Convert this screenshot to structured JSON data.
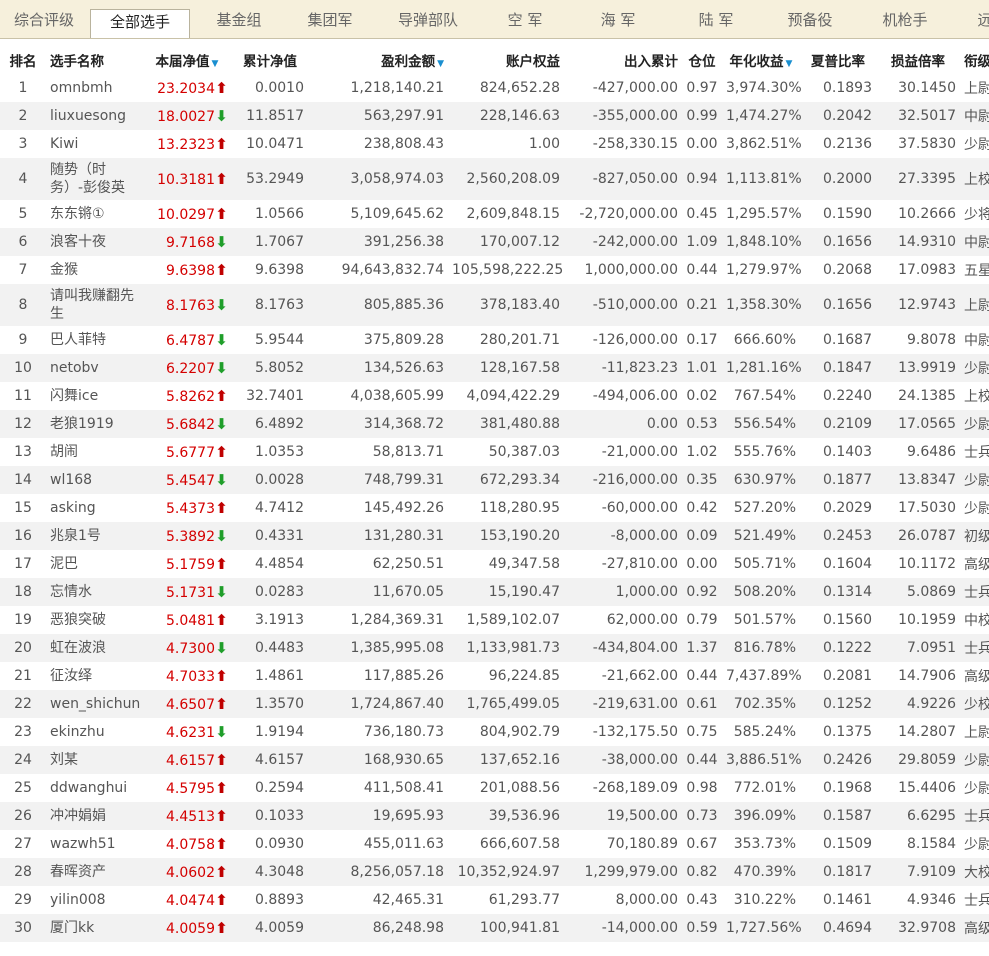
{
  "tabs": [
    {
      "label": "综合评级",
      "active": false
    },
    {
      "label": "全部选手",
      "active": true
    },
    {
      "label": "基金组",
      "active": false
    },
    {
      "label": "集团军",
      "active": false
    },
    {
      "label": "导弹部队",
      "active": false
    },
    {
      "label": "空  军",
      "active": false
    },
    {
      "label": "海  军",
      "active": false
    },
    {
      "label": "陆  军",
      "active": false
    },
    {
      "label": "预备役",
      "active": false
    },
    {
      "label": "机枪手",
      "active": false
    },
    {
      "label": "远",
      "active": false
    }
  ],
  "table": {
    "headers": [
      {
        "label": "排名",
        "sort": false
      },
      {
        "label": "选手名称",
        "sort": false
      },
      {
        "label": "本届净值",
        "sort": true
      },
      {
        "label": "累计净值",
        "sort": false
      },
      {
        "label": "盈利金额",
        "sort": true
      },
      {
        "label": "账户权益",
        "sort": false
      },
      {
        "label": "出入累计",
        "sort": false
      },
      {
        "label": "仓位",
        "sort": false
      },
      {
        "label": "年化收益",
        "sort": true
      },
      {
        "label": "夏普比率",
        "sort": false
      },
      {
        "label": "损益倍率",
        "sort": false
      },
      {
        "label": "衔级",
        "sort": false
      }
    ],
    "sort_arrow": "▼",
    "up_arrow": "⬆",
    "down_arrow": "⬇",
    "rows": [
      {
        "rank": "1",
        "name": "omnbmh",
        "nav": "23.2034",
        "trend": "up",
        "cum": "0.0010",
        "profit": "1,218,140.21",
        "equity": "824,652.28",
        "flow": "-427,000.00",
        "pos": "0.97",
        "annual": "3,974.30%",
        "sharpe": "0.1893",
        "ratio": "30.1450",
        "rank_title": "上尉"
      },
      {
        "rank": "2",
        "name": "liuxuesong",
        "nav": "18.0027",
        "trend": "down",
        "cum": "11.8517",
        "profit": "563,297.91",
        "equity": "228,146.63",
        "flow": "-355,000.00",
        "pos": "0.99",
        "annual": "1,474.27%",
        "sharpe": "0.2042",
        "ratio": "32.5017",
        "rank_title": "中尉"
      },
      {
        "rank": "3",
        "name": "Kiwi",
        "nav": "13.2323",
        "trend": "up",
        "cum": "10.0471",
        "profit": "238,808.43",
        "equity": "1.00",
        "flow": "-258,330.15",
        "pos": "0.00",
        "annual": "3,862.51%",
        "sharpe": "0.2136",
        "ratio": "37.5830",
        "rank_title": "少尉"
      },
      {
        "rank": "4",
        "name": "随势（时务）-彭俊英",
        "nav": "10.3181",
        "trend": "up",
        "cum": "53.2949",
        "profit": "3,058,974.03",
        "equity": "2,560,208.09",
        "flow": "-827,050.00",
        "pos": "0.94",
        "annual": "1,113.81%",
        "sharpe": "0.2000",
        "ratio": "27.3395",
        "rank_title": "上校",
        "tall": true
      },
      {
        "rank": "5",
        "name": "东东锵①",
        "nav": "10.0297",
        "trend": "up",
        "cum": "1.0566",
        "profit": "5,109,645.62",
        "equity": "2,609,848.15",
        "flow": "-2,720,000.00",
        "pos": "0.45",
        "annual": "1,295.57%",
        "sharpe": "0.1590",
        "ratio": "10.2666",
        "rank_title": "少将"
      },
      {
        "rank": "6",
        "name": "浪客十夜",
        "nav": "9.7168",
        "trend": "down",
        "cum": "1.7067",
        "profit": "391,256.38",
        "equity": "170,007.12",
        "flow": "-242,000.00",
        "pos": "1.09",
        "annual": "1,848.10%",
        "sharpe": "0.1656",
        "ratio": "14.9310",
        "rank_title": "中尉"
      },
      {
        "rank": "7",
        "name": "金猴",
        "nav": "9.6398",
        "trend": "up",
        "cum": "9.6398",
        "profit": "94,643,832.74",
        "equity": "105,598,222.25",
        "flow": "1,000,000.00",
        "pos": "0.44",
        "annual": "1,279.97%",
        "sharpe": "0.2068",
        "ratio": "17.0983",
        "rank_title": "五星上将"
      },
      {
        "rank": "8",
        "name": "请叫我赚翻先生",
        "nav": "8.1763",
        "trend": "down",
        "cum": "8.1763",
        "profit": "805,885.36",
        "equity": "378,183.40",
        "flow": "-510,000.00",
        "pos": "0.21",
        "annual": "1,358.30%",
        "sharpe": "0.1656",
        "ratio": "12.9743",
        "rank_title": "上尉",
        "tall": true
      },
      {
        "rank": "9",
        "name": "巴人菲特",
        "nav": "6.4787",
        "trend": "down",
        "cum": "5.9544",
        "profit": "375,809.28",
        "equity": "280,201.71",
        "flow": "-126,000.00",
        "pos": "0.17",
        "annual": "666.60%",
        "sharpe": "0.1687",
        "ratio": "9.8078",
        "rank_title": "中尉"
      },
      {
        "rank": "10",
        "name": "netobv",
        "nav": "6.2207",
        "trend": "down",
        "cum": "5.8052",
        "profit": "134,526.63",
        "equity": "128,167.58",
        "flow": "-11,823.23",
        "pos": "1.01",
        "annual": "1,281.16%",
        "sharpe": "0.1847",
        "ratio": "13.9919",
        "rank_title": "少尉"
      },
      {
        "rank": "11",
        "name": "闪舞ice",
        "nav": "5.8262",
        "trend": "up",
        "cum": "32.7401",
        "profit": "4,038,605.99",
        "equity": "4,094,422.29",
        "flow": "-494,006.00",
        "pos": "0.02",
        "annual": "767.54%",
        "sharpe": "0.2240",
        "ratio": "24.1385",
        "rank_title": "上校"
      },
      {
        "rank": "12",
        "name": "老狼1919",
        "nav": "5.6842",
        "trend": "down",
        "cum": "6.4892",
        "profit": "314,368.72",
        "equity": "381,480.88",
        "flow": "0.00",
        "pos": "0.53",
        "annual": "556.54%",
        "sharpe": "0.2109",
        "ratio": "17.0565",
        "rank_title": "少尉"
      },
      {
        "rank": "13",
        "name": "胡闹",
        "nav": "5.6777",
        "trend": "up",
        "cum": "1.0353",
        "profit": "58,813.71",
        "equity": "50,387.03",
        "flow": "-21,000.00",
        "pos": "1.02",
        "annual": "555.76%",
        "sharpe": "0.1403",
        "ratio": "9.6486",
        "rank_title": "士兵"
      },
      {
        "rank": "14",
        "name": "wl168",
        "nav": "5.4547",
        "trend": "down",
        "cum": "0.0028",
        "profit": "748,799.31",
        "equity": "672,293.34",
        "flow": "-216,000.00",
        "pos": "0.35",
        "annual": "630.97%",
        "sharpe": "0.1877",
        "ratio": "13.8347",
        "rank_title": "少尉"
      },
      {
        "rank": "15",
        "name": "asking",
        "nav": "5.4373",
        "trend": "up",
        "cum": "4.7412",
        "profit": "145,492.26",
        "equity": "118,280.95",
        "flow": "-60,000.00",
        "pos": "0.42",
        "annual": "527.20%",
        "sharpe": "0.2029",
        "ratio": "17.5030",
        "rank_title": "少尉"
      },
      {
        "rank": "16",
        "name": "兆泉1号",
        "nav": "5.3892",
        "trend": "down",
        "cum": "0.4331",
        "profit": "131,280.31",
        "equity": "153,190.20",
        "flow": "-8,000.00",
        "pos": "0.09",
        "annual": "521.49%",
        "sharpe": "0.2453",
        "ratio": "26.0787",
        "rank_title": "初级士官"
      },
      {
        "rank": "17",
        "name": "泥巴",
        "nav": "5.1759",
        "trend": "up",
        "cum": "4.4854",
        "profit": "62,250.51",
        "equity": "49,347.58",
        "flow": "-27,810.00",
        "pos": "0.00",
        "annual": "505.71%",
        "sharpe": "0.1604",
        "ratio": "10.1172",
        "rank_title": "高级士官"
      },
      {
        "rank": "18",
        "name": "忘情水",
        "nav": "5.1731",
        "trend": "down",
        "cum": "0.0283",
        "profit": "11,670.05",
        "equity": "15,190.47",
        "flow": "1,000.00",
        "pos": "0.92",
        "annual": "508.20%",
        "sharpe": "0.1314",
        "ratio": "5.0869",
        "rank_title": "士兵"
      },
      {
        "rank": "19",
        "name": "恶狼突破",
        "nav": "5.0481",
        "trend": "up",
        "cum": "3.1913",
        "profit": "1,284,369.31",
        "equity": "1,589,102.07",
        "flow": "62,000.00",
        "pos": "0.79",
        "annual": "501.57%",
        "sharpe": "0.1560",
        "ratio": "10.1959",
        "rank_title": "中校"
      },
      {
        "rank": "20",
        "name": "虹在波浪",
        "nav": "4.7300",
        "trend": "down",
        "cum": "0.4483",
        "profit": "1,385,995.08",
        "equity": "1,133,981.73",
        "flow": "-434,804.00",
        "pos": "1.37",
        "annual": "816.78%",
        "sharpe": "0.1222",
        "ratio": "7.0951",
        "rank_title": "士兵"
      },
      {
        "rank": "21",
        "name": "征汝绎",
        "nav": "4.7033",
        "trend": "up",
        "cum": "1.4861",
        "profit": "117,885.26",
        "equity": "96,224.85",
        "flow": "-21,662.00",
        "pos": "0.44",
        "annual": "7,437.89%",
        "sharpe": "0.2081",
        "ratio": "14.7906",
        "rank_title": "高级士官"
      },
      {
        "rank": "22",
        "name": "wen_shichun",
        "nav": "4.6507",
        "trend": "up",
        "cum": "1.3570",
        "profit": "1,724,867.40",
        "equity": "1,765,499.05",
        "flow": "-219,631.00",
        "pos": "0.61",
        "annual": "702.35%",
        "sharpe": "0.1252",
        "ratio": "4.9226",
        "rank_title": "少校"
      },
      {
        "rank": "23",
        "name": "ekinzhu",
        "nav": "4.6231",
        "trend": "down",
        "cum": "1.9194",
        "profit": "736,180.73",
        "equity": "804,902.79",
        "flow": "-132,175.50",
        "pos": "0.75",
        "annual": "585.24%",
        "sharpe": "0.1375",
        "ratio": "14.2807",
        "rank_title": "上尉"
      },
      {
        "rank": "24",
        "name": "刘某",
        "nav": "4.6157",
        "trend": "up",
        "cum": "4.6157",
        "profit": "168,930.65",
        "equity": "137,652.16",
        "flow": "-38,000.00",
        "pos": "0.44",
        "annual": "3,886.51%",
        "sharpe": "0.2426",
        "ratio": "29.8059",
        "rank_title": "少尉"
      },
      {
        "rank": "25",
        "name": "ddwanghui",
        "nav": "4.5795",
        "trend": "up",
        "cum": "0.2594",
        "profit": "411,508.41",
        "equity": "201,088.56",
        "flow": "-268,189.09",
        "pos": "0.98",
        "annual": "772.01%",
        "sharpe": "0.1968",
        "ratio": "15.4406",
        "rank_title": "少尉"
      },
      {
        "rank": "26",
        "name": "冲冲娟娟",
        "nav": "4.4513",
        "trend": "up",
        "cum": "0.1033",
        "profit": "19,695.93",
        "equity": "39,536.96",
        "flow": "19,500.00",
        "pos": "0.73",
        "annual": "396.09%",
        "sharpe": "0.1587",
        "ratio": "6.6295",
        "rank_title": "士兵"
      },
      {
        "rank": "27",
        "name": "wazwh51",
        "nav": "4.0758",
        "trend": "up",
        "cum": "0.0930",
        "profit": "455,011.63",
        "equity": "666,607.58",
        "flow": "70,180.89",
        "pos": "0.67",
        "annual": "353.73%",
        "sharpe": "0.1509",
        "ratio": "8.1584",
        "rank_title": "少尉"
      },
      {
        "rank": "28",
        "name": "春晖资产",
        "nav": "4.0602",
        "trend": "up",
        "cum": "4.3048",
        "profit": "8,256,057.18",
        "equity": "10,352,924.97",
        "flow": "1,299,979.00",
        "pos": "0.82",
        "annual": "470.39%",
        "sharpe": "0.1817",
        "ratio": "7.9109",
        "rank_title": "大校"
      },
      {
        "rank": "29",
        "name": "yilin008",
        "nav": "4.0474",
        "trend": "up",
        "cum": "0.8893",
        "profit": "42,465.31",
        "equity": "61,293.77",
        "flow": "8,000.00",
        "pos": "0.43",
        "annual": "310.22%",
        "sharpe": "0.1461",
        "ratio": "4.9346",
        "rank_title": "士兵"
      },
      {
        "rank": "30",
        "name": "厦门kk",
        "nav": "4.0059",
        "trend": "up",
        "cum": "4.0059",
        "profit": "86,248.98",
        "equity": "100,941.81",
        "flow": "-14,000.00",
        "pos": "0.59",
        "annual": "1,727.56%",
        "sharpe": "0.4694",
        "ratio": "32.9708",
        "rank_title": "高级士官"
      }
    ]
  }
}
